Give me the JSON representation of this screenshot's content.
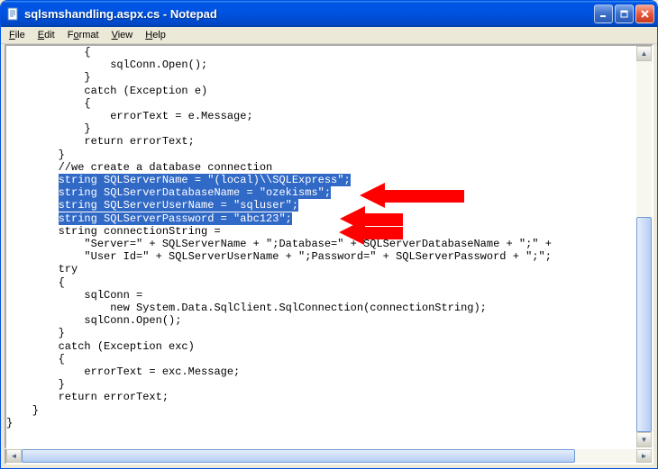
{
  "window": {
    "title": "sqlsmshandling.aspx.cs - Notepad"
  },
  "menu": {
    "file": "File",
    "edit": "Edit",
    "format": "Format",
    "view": "View",
    "help": "Help"
  },
  "code": {
    "l1": "            {",
    "l2": "                sqlConn.Open();",
    "l3": "            }",
    "l4": "            catch (Exception e)",
    "l5": "            {",
    "l6": "                errorText = e.Message;",
    "l7": "            }",
    "l8": "            return errorText;",
    "l9": "        }",
    "l10": "",
    "l11": "        //we create a database connection",
    "hl1_pre": "        ",
    "hl1": "string SQLServerName = \"(local)\\\\SQLExpress\";",
    "hl2_pre": "        ",
    "hl2": "string SQLServerDatabaseName = \"ozekisms\";",
    "hl3_pre": "        ",
    "hl3": "string SQLServerUserName = \"sqluser\";",
    "hl4_pre": "        ",
    "hl4": "string SQLServerPassword = \"abc123\";",
    "l16": "        string connectionString =",
    "l17": "            \"Server=\" + SQLServerName + \";Database=\" + SQLServerDatabaseName + \";\" +",
    "l18": "            \"User Id=\" + SQLServerUserName + \";Password=\" + SQLServerPassword + \";\";",
    "l19": "",
    "l20": "        try",
    "l21": "        {",
    "l22": "            sqlConn =",
    "l23": "                new System.Data.SqlClient.SqlConnection(connectionString);",
    "l24": "            sqlConn.Open();",
    "l25": "        }",
    "l26": "        catch (Exception exc)",
    "l27": "        {",
    "l28": "            errorText = exc.Message;",
    "l29": "        }",
    "l30": "",
    "l31": "        return errorText;",
    "l32": "    }",
    "l33": "}"
  },
  "annotation": {
    "arrow_color": "#ff0000"
  }
}
